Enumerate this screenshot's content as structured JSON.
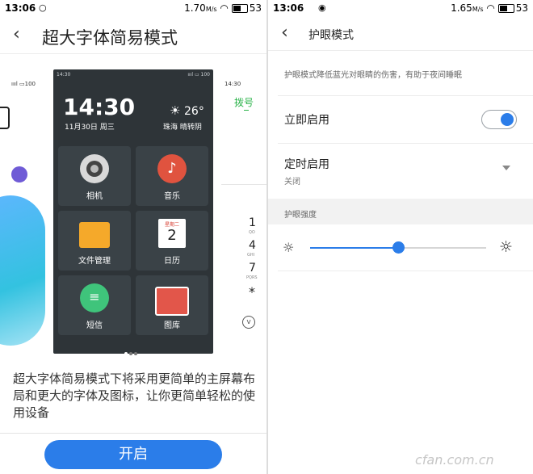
{
  "left": {
    "status": {
      "time": "13:06",
      "network": "1.70",
      "unit": "M/s",
      "battery": "53"
    },
    "header": {
      "title": "超大字体简易模式"
    },
    "preview": {
      "status_time": "14:30",
      "status_battery": "100",
      "clock": "14:30",
      "date": "11月30日 周三",
      "temp": "26°",
      "weather": "珠海 晴转阴",
      "apps": [
        "相机",
        "音乐",
        "文件管理",
        "日历",
        "短信",
        "图库"
      ],
      "calendar_day": "星期二",
      "calendar_num": "2",
      "left_peek_battery": "100",
      "right_peek_time": "14:30",
      "right_peek_label": "拨号",
      "dial_keys": [
        {
          "num": "1",
          "sub": "QO"
        },
        {
          "num": "4",
          "sub": "GHI"
        },
        {
          "num": "7",
          "sub": "PQRS"
        },
        {
          "num": "*",
          "sub": ""
        }
      ]
    },
    "description": "超大字体简易模式下将采用更简单的主屏幕布局和更大的字体及图标，让你更简单轻松的使用设备",
    "button": "开启"
  },
  "right": {
    "status": {
      "time": "13:06",
      "network": "1.65",
      "unit": "M/s",
      "battery": "53"
    },
    "header": {
      "title": "护眼模式"
    },
    "intro": "护眼模式降低蓝光对眼睛的伤害，有助于夜间睡眠",
    "immediate": {
      "label": "立即启用",
      "on": true
    },
    "scheduled": {
      "label": "定时启用",
      "value": "关闭"
    },
    "section": "护眼强度",
    "slider_level": 0.5
  },
  "watermark": "cfan.com.cn",
  "colors": {
    "accent": "#2b7de9",
    "button": "#2b7de9",
    "green": "#2bb34a"
  }
}
